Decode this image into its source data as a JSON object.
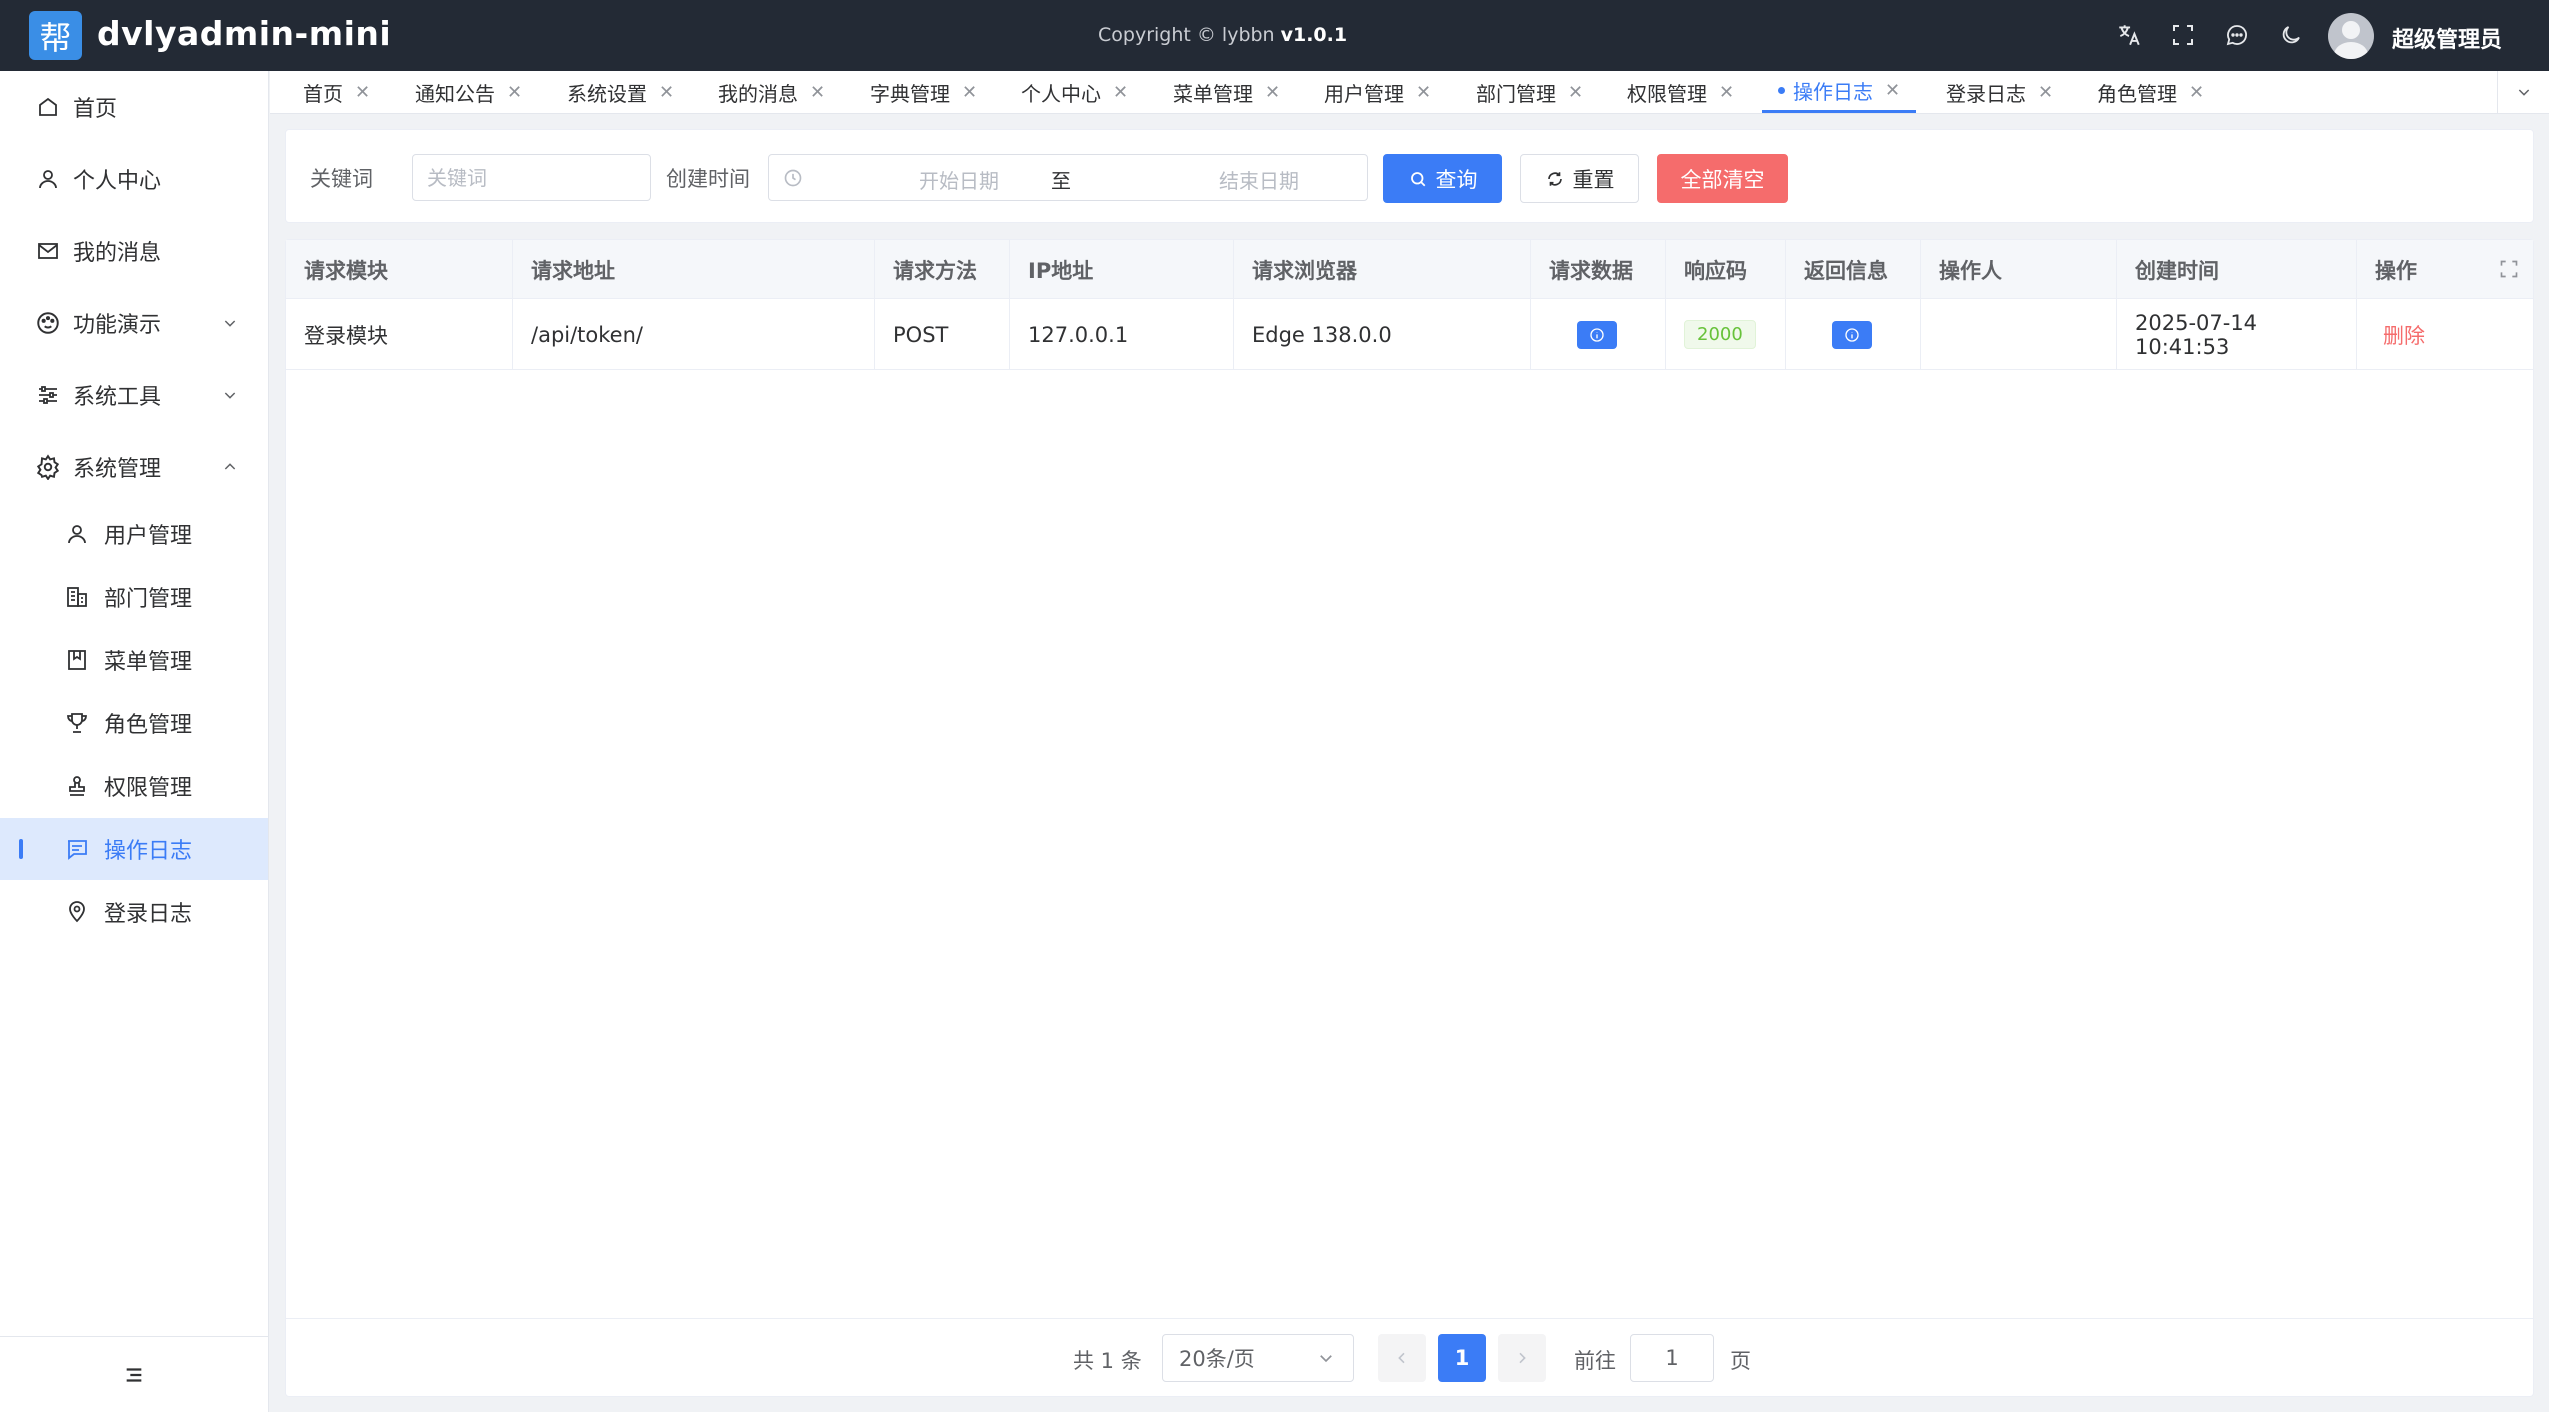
{
  "header": {
    "logo_text": "帮",
    "app_title": "dvlyadmin-mini",
    "copyright": "Copyright © lybbn",
    "version": "v1.0.1",
    "user_name": "超级管理员",
    "icons": [
      "translate-icon",
      "fullscreen-icon",
      "message-icon",
      "moon-icon"
    ]
  },
  "sidebar": {
    "items": [
      {
        "label": "首页",
        "icon": "home-icon"
      },
      {
        "label": "个人中心",
        "icon": "user-icon"
      },
      {
        "label": "我的消息",
        "icon": "mail-icon"
      },
      {
        "label": "功能演示",
        "icon": "palette-icon",
        "arrow": "down"
      },
      {
        "label": "系统工具",
        "icon": "sliders-icon",
        "arrow": "down"
      },
      {
        "label": "系统管理",
        "icon": "gear-icon",
        "arrow": "up"
      }
    ],
    "sub_items": [
      {
        "label": "用户管理",
        "icon": "user-icon"
      },
      {
        "label": "部门管理",
        "icon": "building-icon"
      },
      {
        "label": "菜单管理",
        "icon": "bookmark-icon"
      },
      {
        "label": "角色管理",
        "icon": "trophy-icon"
      },
      {
        "label": "权限管理",
        "icon": "stamp-icon"
      },
      {
        "label": "操作日志",
        "icon": "chat-log-icon",
        "active": true
      },
      {
        "label": "登录日志",
        "icon": "location-icon"
      }
    ],
    "collapse_icon": "collapse-icon"
  },
  "tabs": [
    {
      "label": "首页"
    },
    {
      "label": "通知公告"
    },
    {
      "label": "系统设置"
    },
    {
      "label": "我的消息"
    },
    {
      "label": "字典管理"
    },
    {
      "label": "个人中心"
    },
    {
      "label": "菜单管理"
    },
    {
      "label": "用户管理"
    },
    {
      "label": "部门管理"
    },
    {
      "label": "权限管理"
    },
    {
      "label": "操作日志",
      "active": true
    },
    {
      "label": "登录日志"
    },
    {
      "label": "角色管理"
    }
  ],
  "search": {
    "keyword_label": "关键词",
    "keyword_placeholder": "关键词",
    "keyword_value": "",
    "created_label": "创建时间",
    "start_placeholder": "开始日期",
    "range_separator": "至",
    "end_placeholder": "结束日期",
    "query_label": "查询",
    "reset_label": "重置",
    "clear_all_label": "全部清空"
  },
  "table": {
    "columns": [
      "请求模块",
      "请求地址",
      "请求方法",
      "IP地址",
      "请求浏览器",
      "请求数据",
      "响应码",
      "返回信息",
      "操作人",
      "创建时间",
      "操作"
    ],
    "rows": [
      {
        "module": "登录模块",
        "url": "/api/token/",
        "method": "POST",
        "ip": "127.0.0.1",
        "browser": "Edge 138.0.0",
        "response_code": "2000",
        "operator": "",
        "created": "2025-07-14 10:41:53",
        "action": "删除"
      }
    ]
  },
  "pagination": {
    "total": "共 1 条",
    "page_size": "20条/页",
    "current_page": "1",
    "goto_label": "前往",
    "goto_value": "1",
    "page_unit": "页"
  },
  "colors": {
    "primary": "#3b7cf6",
    "danger": "#f56c6c",
    "success": "#67c23a",
    "header_bg": "#232a35"
  }
}
